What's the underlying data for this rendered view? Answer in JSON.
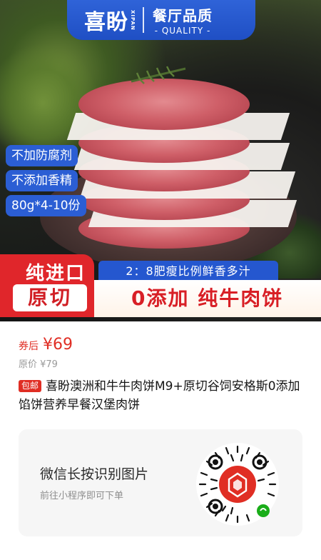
{
  "banner": {
    "brand": "喜盼",
    "brand_en": "XIPAN",
    "quality_zh": "餐厅品质",
    "quality_en": "- QUALITY -"
  },
  "features": [
    "不加防腐剂",
    "不添加香精",
    "80g*4-10份"
  ],
  "bottom_band": {
    "ratio_text": "2：8肥瘦比例鲜香多汁",
    "left_line1": "纯进口",
    "left_line2": "原切",
    "slogan": "0添加 纯牛肉饼"
  },
  "price": {
    "label": "券后",
    "value": "¥69",
    "original": "原价 ¥79"
  },
  "product": {
    "tag": "包邮",
    "title": "喜盼澳洲和牛牛肉饼M9+原切谷饲安格斯0添加馅饼营养早餐汉堡肉饼"
  },
  "mini_card": {
    "title": "微信长按识别图片",
    "subtitle": "前往小程序即可下单"
  },
  "colors": {
    "accent_blue": "#2b5ed4",
    "accent_red": "#e02e24"
  }
}
